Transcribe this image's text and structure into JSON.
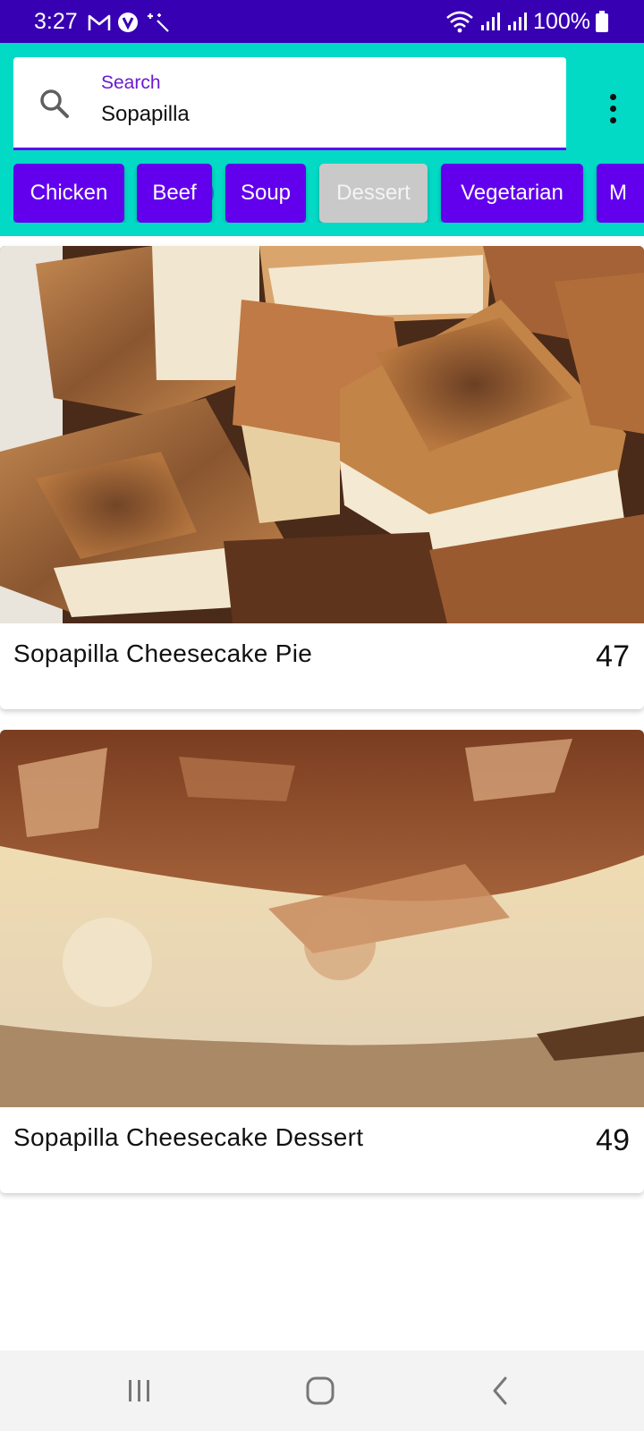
{
  "status_bar": {
    "time": "3:27",
    "left_icons": [
      "gmail-icon",
      "vpn-icon",
      "magic-wand-icon"
    ],
    "right_icons": [
      "wifi-icon",
      "signal-icon",
      "signal-icon"
    ],
    "battery_text": "100%",
    "battery_icon": "battery-icon"
  },
  "search": {
    "label": "Search",
    "value": "Sopapilla",
    "icon": "search-icon"
  },
  "menu": {
    "icon": "more-vert-icon"
  },
  "chips": [
    {
      "label": "Chicken",
      "enabled": true
    },
    {
      "label": "Beef",
      "enabled": true
    },
    {
      "label": "Soup",
      "enabled": true
    },
    {
      "label": "Dessert",
      "enabled": false
    },
    {
      "label": "Vegetarian",
      "enabled": true
    },
    {
      "label": "M",
      "enabled": true
    }
  ],
  "recipes": [
    {
      "title": "Sopapilla Cheesecake Pie",
      "rating": "47"
    },
    {
      "title": "Sopapilla Cheesecake Dessert",
      "rating": "49"
    }
  ],
  "nav_bar": {
    "buttons": [
      "recent-apps-icon",
      "home-icon",
      "back-icon"
    ]
  },
  "colors": {
    "status_bar": "#3700b3",
    "primary": "#6200ee",
    "secondary": "#03dac5",
    "chip_disabled": "#c9c9c9"
  }
}
